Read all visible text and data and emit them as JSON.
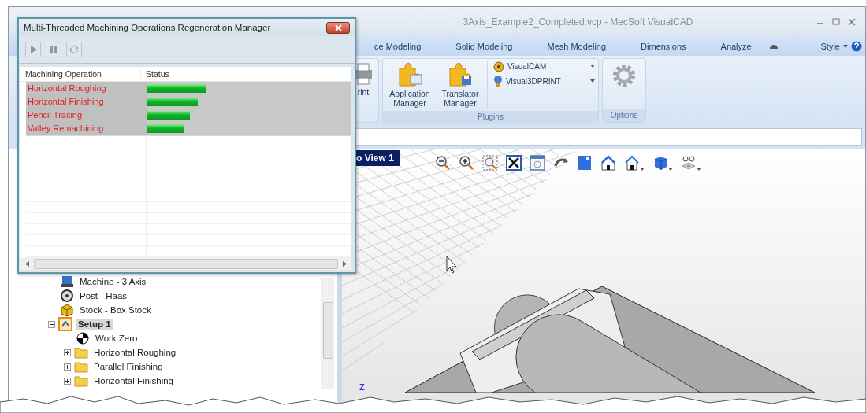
{
  "app": {
    "title": "3Axis_Example2_Completed.vcp - MecSoft VisualCAD"
  },
  "ribbon_tabs": [
    {
      "label": "ce Modeling"
    },
    {
      "label": "Solid Modeling"
    },
    {
      "label": "Mesh Modeling"
    },
    {
      "label": "Dimensions"
    },
    {
      "label": "Analyze"
    }
  ],
  "style_menu": {
    "label": "Style"
  },
  "ribbon_groups": [
    {
      "kind": "clipped",
      "large_buttons": [
        {
          "label": "rint"
        }
      ]
    },
    {
      "kind": "plugins",
      "label": "Plugins",
      "large_buttons": [
        {
          "label": "Application Manager"
        },
        {
          "label": "Translator Manager"
        }
      ],
      "small_buttons": [
        {
          "label": "VisualCAM"
        },
        {
          "label": "Visual3DPRINT"
        }
      ]
    },
    {
      "kind": "options",
      "label": "Options"
    }
  ],
  "viewport": {
    "tab": "o View 1",
    "axis_label": "Z"
  },
  "tree": [
    {
      "kind": "machine",
      "label": "Machine - 3 Axis",
      "selected": false
    },
    {
      "kind": "post",
      "label": "Post - Haas",
      "selected": false
    },
    {
      "kind": "stock",
      "label": "Stock - Box Stock",
      "selected": false
    },
    {
      "kind": "setup",
      "label": "Setup 1",
      "selected": true,
      "expanded": true,
      "children": [
        {
          "kind": "work_zero",
          "label": "Work Zero",
          "selected": false
        },
        {
          "kind": "folder",
          "label": "Horizontal Roughing",
          "selected": false,
          "expanded": false
        },
        {
          "kind": "folder",
          "label": "Parallel Finishing",
          "selected": false,
          "expanded": false
        },
        {
          "kind": "folder",
          "label": "Horizontal Finishing",
          "selected": false,
          "expanded": false
        }
      ]
    }
  ],
  "dialog": {
    "title": "Multi-Threaded Machining Operations Regeneration Manager",
    "toolbar": [
      {
        "kind": "play",
        "disabled": true
      },
      {
        "kind": "pause",
        "disabled": true
      },
      {
        "kind": "stop",
        "disabled": true
      }
    ],
    "columns": [
      "Machining Operation",
      "Status"
    ],
    "rows": [
      {
        "operation": "Horizontal Roughing",
        "level": 0.29
      },
      {
        "operation": "Horizontal Finishing",
        "level": 0.25
      },
      {
        "operation": "Pencil Tracing",
        "level": 0.21
      },
      {
        "operation": "Valley Remachining",
        "level": 0.18
      }
    ]
  }
}
